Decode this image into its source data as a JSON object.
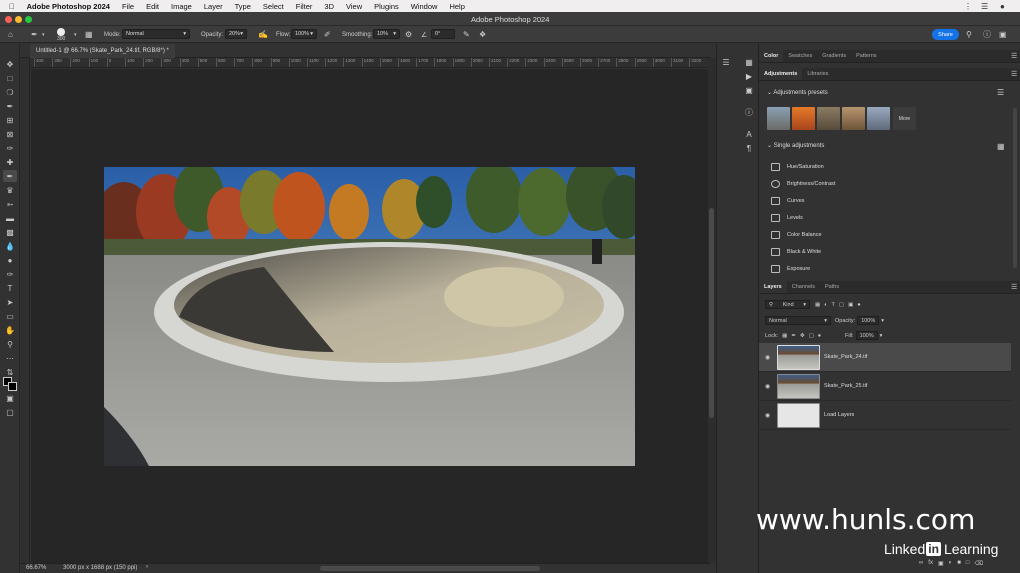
{
  "menubar": {
    "app_name": "Adobe Photoshop 2024",
    "items": [
      "File",
      "Edit",
      "Image",
      "Layer",
      "Type",
      "Select",
      "Filter",
      "3D",
      "View",
      "Plugins",
      "Window",
      "Help"
    ]
  },
  "window": {
    "title": "Adobe Photoshop 2024"
  },
  "options_bar": {
    "brush_size": "300",
    "mode_label": "Mode:",
    "mode_value": "Normal",
    "opacity_label": "Opacity:",
    "opacity_value": "20%",
    "flow_label": "Flow:",
    "flow_value": "100%",
    "smoothing_label": "Smoothing:",
    "smoothing_value": "10%",
    "angle_value": "0°",
    "share_label": "Share"
  },
  "document": {
    "tab_label": "Untitled-1 @ 66.7% (Skate_Park_24.tif, RGB/8*) *",
    "ruler_marks": [
      "400",
      "300",
      "200",
      "100",
      "0",
      "100",
      "200",
      "300",
      "400",
      "500",
      "600",
      "700",
      "800",
      "900",
      "1000",
      "1100",
      "1200",
      "1300",
      "1400",
      "1500",
      "1600",
      "1700",
      "1800",
      "1900",
      "2000",
      "2100",
      "2200",
      "2300",
      "2400",
      "2500",
      "2600",
      "2700",
      "2800",
      "2900",
      "3000",
      "3100",
      "3200",
      "3300"
    ]
  },
  "status": {
    "zoom": "66.67%",
    "doc_info": "3000 px x 1688 px (150 ppi)"
  },
  "top_tabs": [
    "Color",
    "Swatches",
    "Gradients",
    "Patterns"
  ],
  "adjust_tabs": [
    "Adjustments",
    "Libraries"
  ],
  "adjustments": {
    "presets_label": "Adjustments presets",
    "more_label": "More",
    "single_label": "Single adjustments",
    "items": [
      "Hue/Saturation",
      "Brightness/Contrast",
      "Curves",
      "Levels",
      "Color Balance",
      "Black & White",
      "Exposure"
    ]
  },
  "layers_tabs": [
    "Layers",
    "Channels",
    "Paths"
  ],
  "layers": {
    "kind_label": "Kind",
    "blend_mode": "Normal",
    "opacity_label": "Opacity:",
    "opacity_value": "100%",
    "lock_label": "Lock:",
    "fill_label": "Fill:",
    "fill_value": "100%",
    "items": [
      "Skate_Park_24.tif",
      "Skate_Park_25.tif",
      "Load Layers"
    ]
  },
  "overlay": {
    "watermark": "www.hunls.com",
    "brand_pre": "Linked",
    "brand_in": "in",
    "brand_post": "Learning"
  },
  "colors": {
    "accent": "#1473e6",
    "panel": "#323232",
    "canvas_bg": "#262626"
  },
  "icons": [
    "apple-icon",
    "home-icon",
    "brush-icon",
    "search-icon",
    "question-icon",
    "grid-icon"
  ]
}
